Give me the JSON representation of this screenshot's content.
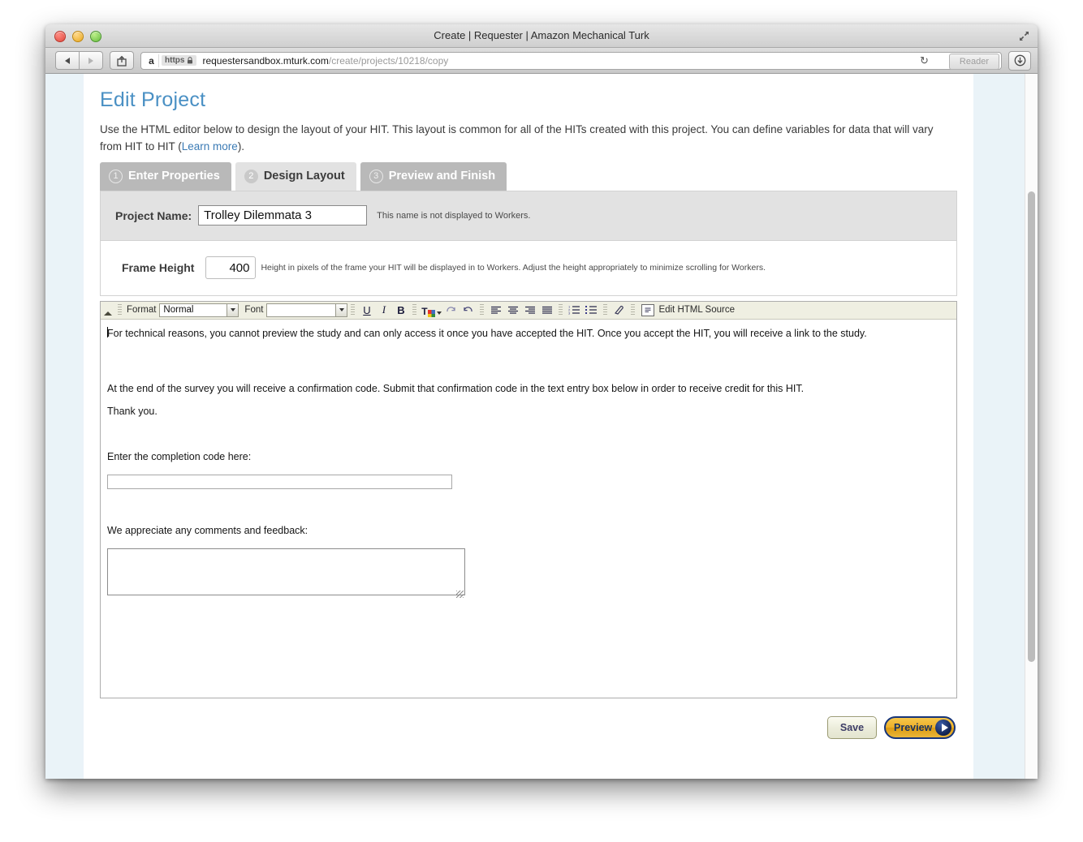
{
  "window": {
    "title": "Create | Requester | Amazon Mechanical Turk",
    "traffic_lights": [
      "close-button",
      "minimize-button",
      "zoom-button"
    ],
    "fullscreen_icon": "fullscreen-expand-icon"
  },
  "browser": {
    "back_icon": "back-arrow-icon",
    "forward_icon": "forward-arrow-icon",
    "share_icon": "share-icon",
    "favicon": "amazon-favicon",
    "scheme_label": "https",
    "lock_icon": "lock-icon",
    "url_host": "requestersandbox.mturk.com",
    "url_path": "/create/projects/10218/copy",
    "reload_icon": "reload-icon",
    "reader_label": "Reader",
    "downloads_icon": "downloads-icon"
  },
  "page": {
    "title": "Edit Project",
    "intro_part1": "Use the HTML editor below to design the layout of your HIT. This layout is common for all of the HITs created with this project. You can define variables for data that will vary from HIT to HIT (",
    "intro_link": "Learn more",
    "intro_part2": ").",
    "tabs": [
      {
        "number": "1",
        "label": "Enter Properties",
        "state": "inactive"
      },
      {
        "number": "2",
        "label": "Design Layout",
        "state": "active"
      },
      {
        "number": "3",
        "label": "Preview and Finish",
        "state": "inactive"
      }
    ],
    "project_name": {
      "label": "Project Name:",
      "value": "Trolley Dilemmata 3",
      "placeholder": "",
      "hint": "This name is not displayed to Workers."
    },
    "frame_height": {
      "label": "Frame Height",
      "value": "400",
      "placeholder": "",
      "hint": "Height in pixels of the frame your HIT will be displayed in to Workers. Adjust the height appropriately to minimize scrolling for Workers."
    }
  },
  "editor": {
    "toolbar": {
      "collapse_icon": "collapse-triangle-icon",
      "format_label": "Format",
      "format_value": "Normal",
      "format_options": [
        "Normal"
      ],
      "font_label": "Font",
      "font_value": "",
      "font_options": [],
      "underline_label": "U",
      "italic_label": "I",
      "bold_label": "B",
      "text_color_label": "T",
      "redo_icon": "redo-icon",
      "undo_icon": "undo-icon",
      "align_left_icon": "align-left-icon",
      "align_center_icon": "align-center-icon",
      "align_right_icon": "align-right-icon",
      "align_justify_icon": "align-justify-icon",
      "ordered_list_icon": "ordered-list-icon",
      "unordered_list_icon": "unordered-list-icon",
      "eraser_icon": "eraser-icon",
      "html_source_icon": "html-source-icon",
      "html_source_label": "Edit HTML Source"
    },
    "content": {
      "para1": "For technical reasons, you cannot preview the study and can only access it once you have accepted the HIT. Once you accept the HIT, you will receive a link to the study.",
      "para2": "At the end of the survey you will receive a confirmation code. Submit that confirmation code in the text entry box below in order to receive credit for this HIT.",
      "para3": "Thank you.",
      "code_label": "Enter the completion code here:",
      "code_value": "",
      "code_placeholder": "",
      "comments_label": "We appreciate any comments and feedback:",
      "comments_value": "",
      "comments_placeholder": ""
    }
  },
  "footer": {
    "save_label": "Save",
    "preview_label": "Preview",
    "preview_arrow_icon": "arrow-right-circle-icon"
  },
  "colors": {
    "title_blue": "#4a90c4",
    "link_blue": "#3b7bb5",
    "tab_inactive": "#b9b9b9",
    "tab_active": "#e2e2e2",
    "panel_grey": "#e2e2e2",
    "toolbar_cream": "#efefe2",
    "preview_gold": "#edb12b",
    "preview_border_navy": "#17357a",
    "page_side_blue": "#eaf3f8"
  }
}
